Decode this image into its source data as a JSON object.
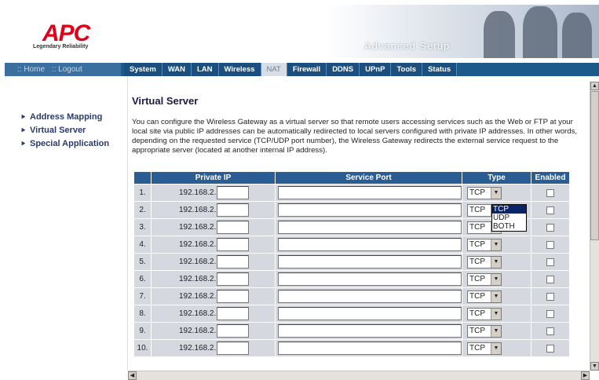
{
  "header": {
    "logo": "APC",
    "tagline": "Legendary Reliability",
    "banner": "Advanced Setup"
  },
  "nav": {
    "home": ":: Home",
    "logout": ":: Logout",
    "tabs": [
      "System",
      "WAN",
      "LAN",
      "Wireless",
      "NAT",
      "Firewall",
      "DDNS",
      "UPnP",
      "Tools",
      "Status"
    ],
    "active": "NAT"
  },
  "menu": [
    "Address Mapping",
    "Virtual Server",
    "Special Application"
  ],
  "page": {
    "title": "Virtual Server",
    "description": "You can configure the Wireless Gateway as a virtual server so that remote users accessing services such as the Web or FTP at your local site via public IP addresses can be automatically redirected to local servers configured with private IP addresses. In other words, depending on the requested service (TCP/UDP port number), the Wireless Gateway redirects the external service request to the appropriate server (located at another internal IP address)."
  },
  "table": {
    "headers": [
      "",
      "Private IP",
      "Service Port",
      "Type",
      "Enabled"
    ],
    "ip_prefix": "192.168.2.",
    "rows": [
      {
        "num": "1.",
        "type": "TCP"
      },
      {
        "num": "2.",
        "type": "TCP"
      },
      {
        "num": "3.",
        "type": "TCP"
      },
      {
        "num": "4.",
        "type": "TCP"
      },
      {
        "num": "5.",
        "type": "TCP"
      },
      {
        "num": "6.",
        "type": "TCP"
      },
      {
        "num": "7.",
        "type": "TCP"
      },
      {
        "num": "8.",
        "type": "TCP"
      },
      {
        "num": "9.",
        "type": "TCP"
      },
      {
        "num": "10.",
        "type": "TCP"
      }
    ]
  },
  "dropdown": {
    "options": [
      "TCP",
      "UDP",
      "BOTH"
    ],
    "highlighted": "TCP"
  }
}
